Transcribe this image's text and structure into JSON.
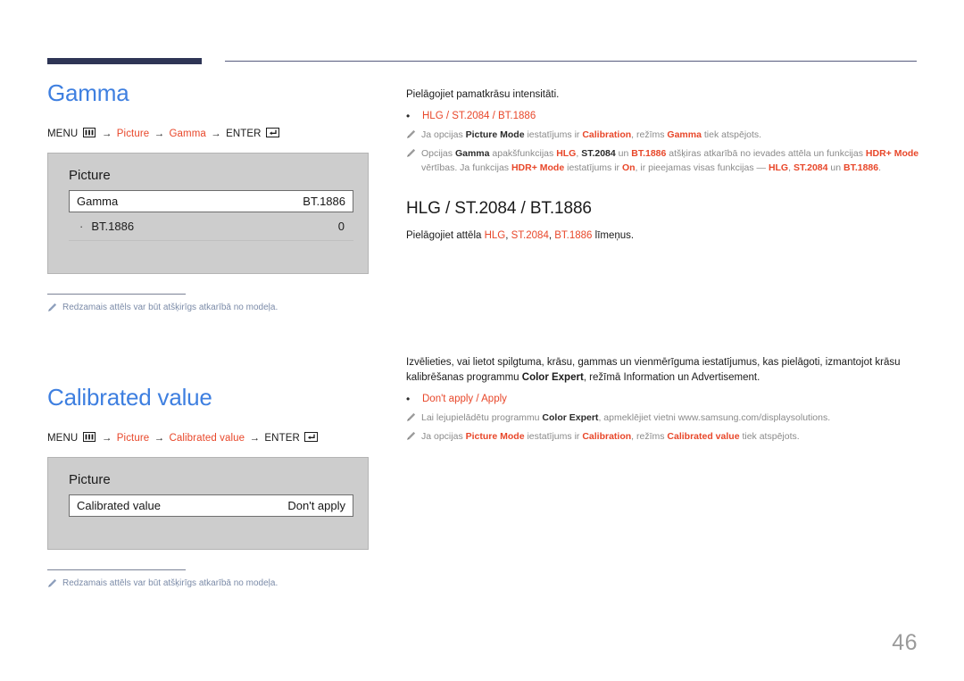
{
  "header": {
    "accent_color": "#2e3555",
    "rule_color": "#565b7d"
  },
  "page_number": "46",
  "colors": {
    "heading_blue": "#3e7fe0",
    "highlight_red": "#e8472a",
    "note_gray": "#8a8a8a",
    "footnote_blue": "#7b8ba8"
  },
  "sections": [
    {
      "title": "Gamma",
      "menu_path": {
        "menu_label": "MENU",
        "menu_icon": "menu-grid-icon",
        "arrow": "→",
        "steps": [
          "Picture",
          "Gamma"
        ],
        "enter_label": "ENTER",
        "enter_icon": "enter-return-icon"
      },
      "osd": {
        "title": "Picture",
        "row": {
          "label": "Gamma",
          "value": "BT.1886"
        },
        "sub_row": {
          "label": "BT.1886",
          "value": "0"
        }
      },
      "footnote": "Redzamais attēls var būt atšķirīgs atkarībā no modeļa."
    },
    {
      "title": "Calibrated value",
      "menu_path": {
        "menu_label": "MENU",
        "menu_icon": "menu-grid-icon",
        "arrow": "→",
        "steps": [
          "Picture",
          "Calibrated value"
        ],
        "enter_label": "ENTER",
        "enter_icon": "enter-return-icon"
      },
      "osd": {
        "title": "Picture",
        "row": {
          "label": "Calibrated value",
          "value": "Don't apply"
        }
      },
      "footnote": "Redzamais attēls var būt atšķirīgs atkarībā no modeļa."
    }
  ],
  "right": {
    "gamma": {
      "intro": "Pielāgojiet pamatkrāsu intensitāti.",
      "bullet": "HLG / ST.2084 / BT.1886",
      "note1_parts": [
        {
          "t": "Ja opcijas ",
          "s": "n"
        },
        {
          "t": "Picture Mode",
          "s": "b"
        },
        {
          "t": " iestatījums ir ",
          "s": "n"
        },
        {
          "t": "Calibration",
          "s": "r"
        },
        {
          "t": ", režīms ",
          "s": "n"
        },
        {
          "t": "Gamma",
          "s": "r"
        },
        {
          "t": " tiek atspējots.",
          "s": "n"
        }
      ],
      "note2_parts": [
        {
          "t": "Opcijas ",
          "s": "n"
        },
        {
          "t": "Gamma",
          "s": "b"
        },
        {
          "t": " apakšfunkcijas ",
          "s": "n"
        },
        {
          "t": "HLG",
          "s": "r"
        },
        {
          "t": ", ",
          "s": "n"
        },
        {
          "t": "ST.2084",
          "s": "b"
        },
        {
          "t": " un ",
          "s": "n"
        },
        {
          "t": "BT.1886",
          "s": "r"
        },
        {
          "t": " atšķiras atkarībā no ievades attēla un funkcijas ",
          "s": "n"
        },
        {
          "t": "HDR+ Mode",
          "s": "r"
        },
        {
          "t": " vērtības. Ja funkcijas ",
          "s": "n"
        },
        {
          "t": "HDR+ Mode",
          "s": "r"
        },
        {
          "t": " iestatījums ir ",
          "s": "n"
        },
        {
          "t": "On",
          "s": "r"
        },
        {
          "t": ", ir pieejamas visas funkcijas — ",
          "s": "n"
        },
        {
          "t": "HLG",
          "s": "r"
        },
        {
          "t": ", ",
          "s": "n"
        },
        {
          "t": "ST.2084",
          "s": "r"
        },
        {
          "t": " un ",
          "s": "n"
        },
        {
          "t": "BT.1886",
          "s": "r"
        },
        {
          "t": ".",
          "s": "n"
        }
      ],
      "subheading": "HLG / ST.2084 / BT.1886",
      "sub_desc_parts": [
        {
          "t": "Pielāgojiet attēla ",
          "s": "n"
        },
        {
          "t": "HLG",
          "s": "r"
        },
        {
          "t": ", ",
          "s": "n"
        },
        {
          "t": "ST.2084",
          "s": "r"
        },
        {
          "t": ", ",
          "s": "n"
        },
        {
          "t": "BT.1886",
          "s": "r"
        },
        {
          "t": " līmeņus.",
          "s": "n"
        }
      ]
    },
    "calibrated": {
      "intro_parts": [
        {
          "t": "Izvēlieties, vai lietot spilgtuma, krāsu, gammas un vienmērīguma iestatījumus, kas pielāgoti, izmantojot krāsu kalibrēšanas programmu ",
          "s": "n"
        },
        {
          "t": "Color Expert",
          "s": "b"
        },
        {
          "t": ", režīmā Information un Advertisement.",
          "s": "n"
        }
      ],
      "bullet": "Don't apply / Apply",
      "note1_parts": [
        {
          "t": "Lai lejupielādētu programmu ",
          "s": "n"
        },
        {
          "t": "Color Expert",
          "s": "b"
        },
        {
          "t": ", apmeklējiet vietni www.samsung.com/displaysolutions.",
          "s": "n"
        }
      ],
      "note2_parts": [
        {
          "t": "Ja opcijas ",
          "s": "n"
        },
        {
          "t": "Picture Mode",
          "s": "r"
        },
        {
          "t": " iestatījums ir ",
          "s": "n"
        },
        {
          "t": "Calibration",
          "s": "r"
        },
        {
          "t": ", režīms ",
          "s": "n"
        },
        {
          "t": "Calibrated value",
          "s": "r"
        },
        {
          "t": " tiek atspējots.",
          "s": "n"
        }
      ]
    }
  }
}
